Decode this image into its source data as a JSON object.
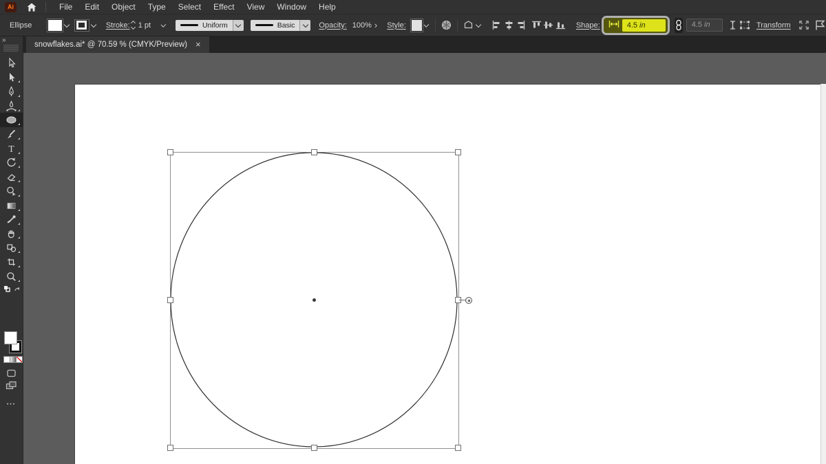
{
  "app": {
    "logo_text": "Ai"
  },
  "menu": {
    "items": [
      "File",
      "Edit",
      "Object",
      "Type",
      "Select",
      "Effect",
      "View",
      "Window",
      "Help"
    ]
  },
  "control_bar": {
    "tool_name": "Ellipse",
    "stroke_label": "Stroke:",
    "stroke_value": "1 pt",
    "profile_value": "Uniform",
    "brush_value": "Basic",
    "opacity_label": "Opacity:",
    "opacity_value": "100%",
    "more_glyph": "›",
    "style_label": "Style:",
    "shape_label": "Shape:",
    "width_value": "4.5",
    "width_unit": "in",
    "height_value": "4.5",
    "height_unit": "in",
    "transform_label": "Transform"
  },
  "tab_bar": {
    "document_title": "snowflakes.ai* @ 70.59 % (CMYK/Preview)",
    "close_glyph": "×",
    "collapse_glyph": "»"
  },
  "toolbar": {
    "active_tool": "ellipse",
    "tools": [
      "selection",
      "direct-selection",
      "pen",
      "curvature",
      "ellipse",
      "paintbrush",
      "type",
      "rotate",
      "eraser",
      "shape-builder",
      "gradient",
      "eyedropper",
      "hand",
      "symbols",
      "artboard",
      "zoom"
    ],
    "type_tool_glyph": "T",
    "overflow_glyph": "•••"
  },
  "colors": {
    "highlight_yellow": "#dde21b",
    "highlight_ring": "#b0b0b0",
    "ui_dark": "#323232",
    "canvas_gray": "#5c5c5c",
    "artboard_white": "#ffffff",
    "logo_orange": "#ff7a1a",
    "none_slash_red": "#d22"
  }
}
